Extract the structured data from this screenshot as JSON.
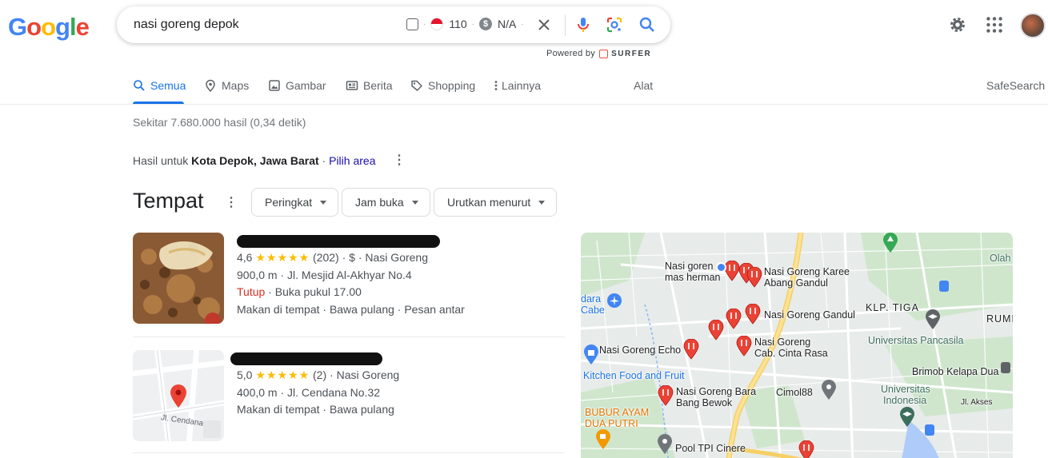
{
  "logo": [
    "G",
    "o",
    "o",
    "g",
    "l",
    "e"
  ],
  "logo_colors": [
    "#4285F4",
    "#EA4335",
    "#FBBC05",
    "#4285F4",
    "#34A853",
    "#EA4335"
  ],
  "search": {
    "query": "nasi goreng depok",
    "ext_rank": "110",
    "ext_value": "N/A",
    "powered_by": "Powered by",
    "surfer": "SURFER"
  },
  "tabs": [
    {
      "label": "Semua",
      "icon": "search-icon",
      "active": true
    },
    {
      "label": "Maps",
      "icon": "map-pin-icon"
    },
    {
      "label": "Gambar",
      "icon": "image-icon"
    },
    {
      "label": "Berita",
      "icon": "news-icon"
    },
    {
      "label": "Shopping",
      "icon": "tag-icon"
    },
    {
      "label": "Lainnya",
      "icon": "more-vert-icon"
    }
  ],
  "tools_label": "Alat",
  "safesearch_label": "SafeSearch",
  "stats": "Sekitar 7.680.000 hasil (0,34 detik)",
  "location": {
    "prefix": "Hasil untuk",
    "place": "Kota Depok, Jawa Barat",
    "separator": "·",
    "change": "Pilih area"
  },
  "places": {
    "title": "Tempat",
    "filters": [
      "Peringkat",
      "Jam buka",
      "Urutkan menurut"
    ],
    "results": [
      {
        "rating": "4,6",
        "stars": "★★★★★",
        "reviews": "(202)",
        "price": "$",
        "category": "Nasi Goreng",
        "distance": "900,0 m",
        "address": "Jl. Mesjid Al-Akhyar No.4",
        "status": "Tutup",
        "hours": "Buka pukul 17.00",
        "services": "Makan di tempat · Bawa pulang · Pesan antar"
      },
      {
        "rating": "5,0",
        "stars": "★★★★★",
        "reviews": "(2)",
        "category": "Nasi Goreng",
        "distance": "400,0 m",
        "address": "Jl. Cendana No.32",
        "services": "Makan di tempat · Bawa pulang",
        "map_label": "Jl. Cendana"
      }
    ]
  },
  "map": {
    "labels": {
      "nasi_goren": "Nasi goren",
      "mas_herman": "mas herman",
      "karee1": "Nasi Goreng Karee",
      "karee2": "Abang Gandul",
      "gandul": "Nasi Goreng Gandul",
      "echo": "Nasi Goreng Echo",
      "cinta1": "Nasi Goreng",
      "cinta2": "Cab. Cinta Rasa",
      "klp": "KLP. TIGA",
      "rumb": "RUMB",
      "olah": "Olah",
      "dara1": "dara",
      "dara2": "Cabe",
      "univ_pancasila": "Universitas Pancasila",
      "kitchen": "Kitchen Food and Fruit",
      "brimob": "Brimob Kelapa Dua",
      "bara1": "Nasi Goreng Bara",
      "bara2": "Bang Bewok",
      "cimol": "Cimol88",
      "ui1": "Universitas",
      "ui2": "Indonesia",
      "jl_akses": "Jl. Akses",
      "bubur1": "BUBUR AYAM",
      "bubur2": "DUA PUTRI",
      "pool": "Pool TPI Cinere"
    }
  }
}
